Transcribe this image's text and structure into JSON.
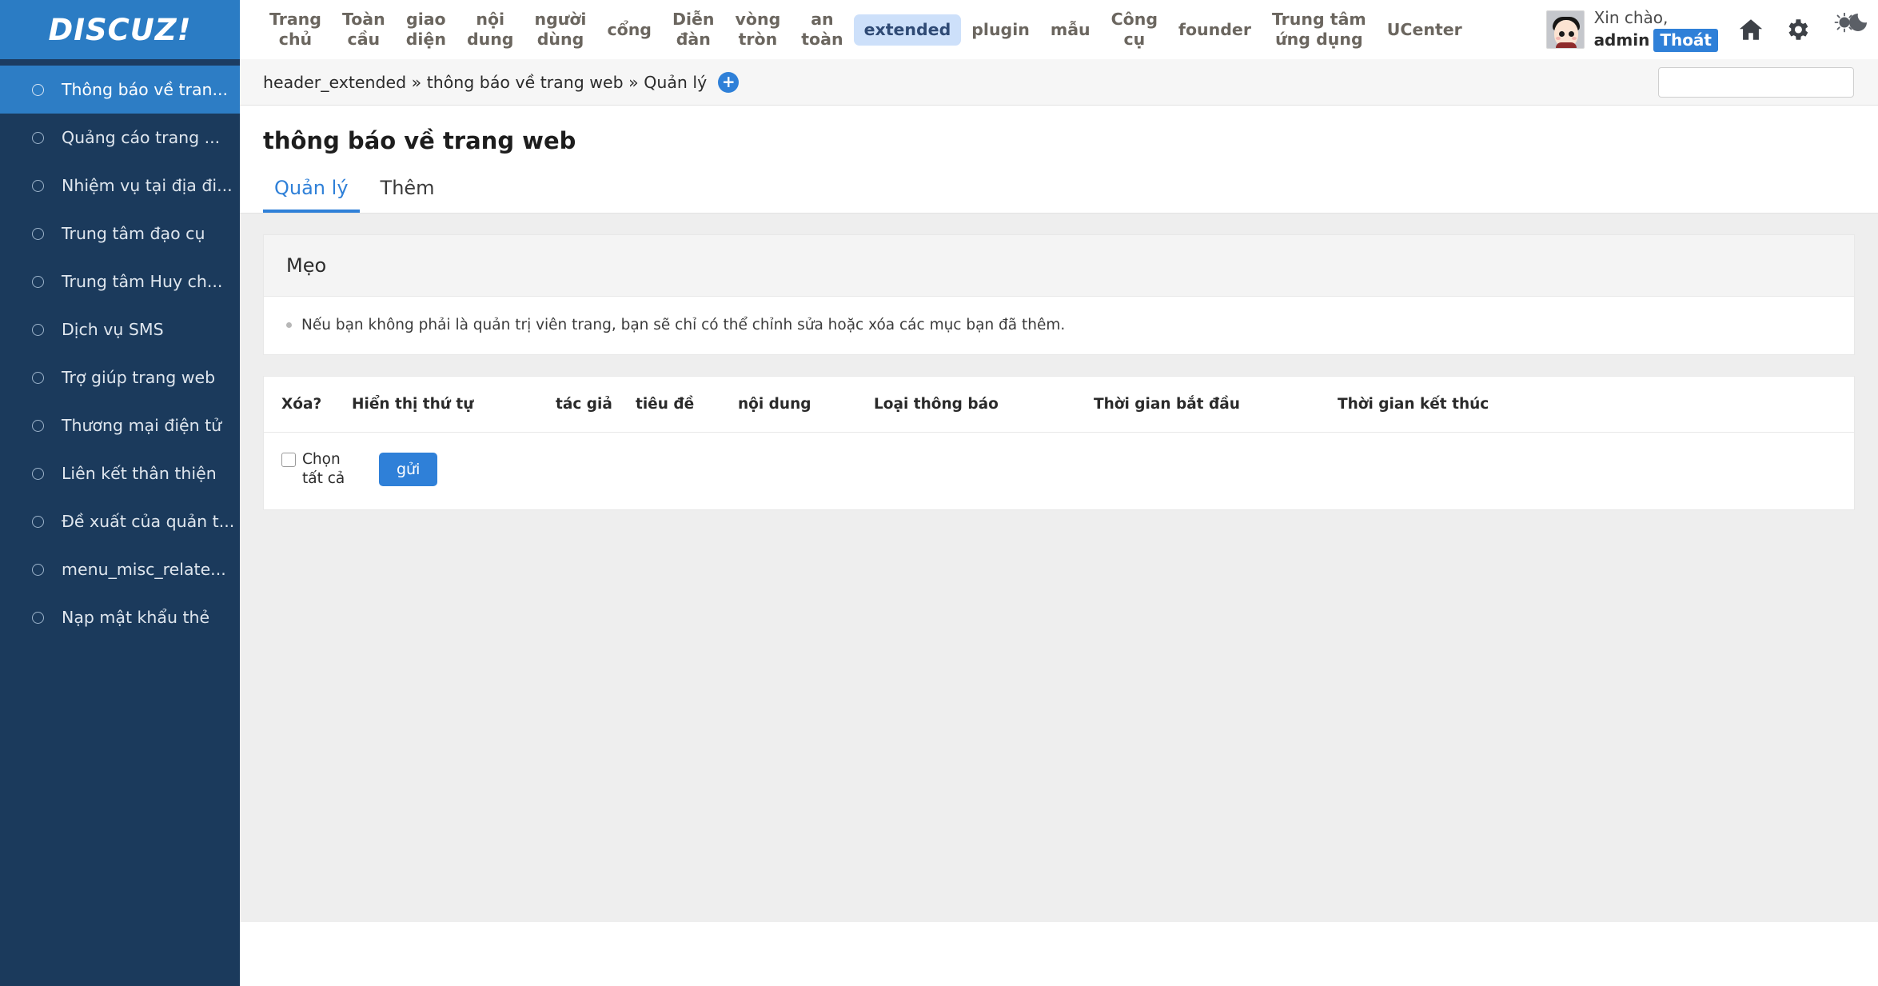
{
  "brand": {
    "logo_text": "DISCUZ!"
  },
  "topnav": {
    "items": [
      {
        "label": "Trang\nchủ",
        "active": false
      },
      {
        "label": "Toàn\ncầu",
        "active": false
      },
      {
        "label": "giao\ndiện",
        "active": false
      },
      {
        "label": "nội\ndung",
        "active": false
      },
      {
        "label": "người\ndùng",
        "active": false
      },
      {
        "label": "cổng",
        "active": false
      },
      {
        "label": "Diễn\nđàn",
        "active": false
      },
      {
        "label": "vòng\ntròn",
        "active": false
      },
      {
        "label": "an\ntoàn",
        "active": false
      },
      {
        "label": "extended",
        "active": true
      },
      {
        "label": "plugin",
        "active": false
      },
      {
        "label": "mẫu",
        "active": false
      },
      {
        "label": "Công\ncụ",
        "active": false
      },
      {
        "label": "founder",
        "active": false
      },
      {
        "label": "Trung tâm\nứng dụng",
        "active": false
      },
      {
        "label": "UCenter",
        "active": false
      }
    ]
  },
  "user": {
    "greeting": "Xin chào,",
    "name": "admin",
    "logout_label": "Thoát",
    "avatar_icon": "user-avatar",
    "home_icon": "home-icon",
    "settings_icon": "gear-icon",
    "theme_icon": "sun-moon-toggle-icon"
  },
  "sidebar": {
    "items": [
      {
        "label": "Thông báo về tran...",
        "active": true
      },
      {
        "label": "Quảng cáo trang ...",
        "active": false
      },
      {
        "label": "Nhiệm vụ tại địa đi...",
        "active": false
      },
      {
        "label": "Trung tâm đạo cụ",
        "active": false
      },
      {
        "label": "Trung tâm Huy ch...",
        "active": false
      },
      {
        "label": "Dịch vụ SMS",
        "active": false
      },
      {
        "label": "Trợ giúp trang web",
        "active": false
      },
      {
        "label": "Thương mại điện tử",
        "active": false
      },
      {
        "label": "Liên kết thân thiện",
        "active": false
      },
      {
        "label": "Đề xuất của quản t...",
        "active": false
      },
      {
        "label": "menu_misc_relate...",
        "active": false
      },
      {
        "label": "Nạp mật khẩu thẻ",
        "active": false
      }
    ]
  },
  "breadcrumb": {
    "text": "header_extended » thông báo về trang web » Quản lý",
    "add_label": "+",
    "add_icon": "plus-icon"
  },
  "search": {
    "value": "",
    "placeholder": "",
    "icon": "search-icon"
  },
  "page": {
    "title": "thông báo về trang web",
    "tabs": [
      {
        "label": "Quản lý",
        "active": true
      },
      {
        "label": "Thêm",
        "active": false
      }
    ]
  },
  "tips": {
    "header": "Mẹo",
    "items": [
      "Nếu bạn không phải là quản trị viên trang, bạn sẽ chỉ có thể chỉnh sửa hoặc xóa các mục bạn đã thêm."
    ]
  },
  "table": {
    "columns": [
      "Xóa?",
      "Hiển thị thứ tự",
      "tác giả",
      "tiêu đề",
      "nội dung",
      "Loại thông báo",
      "Thời gian bắt đầu",
      "Thời gian kết thúc"
    ],
    "rows": []
  },
  "footer": {
    "select_all_label": "Chọn tất cả",
    "select_all_checked": false,
    "submit_label": "gửi"
  },
  "colors": {
    "brand_blue": "#2b7cc4",
    "sidebar_navy": "#1b3a5c",
    "sidebar_active": "#2d7dc5",
    "accent_blue": "#2f80d8",
    "nav_active_bg": "#cde0fa",
    "page_bg": "#eeeeee",
    "card_bg": "#fafafa"
  }
}
